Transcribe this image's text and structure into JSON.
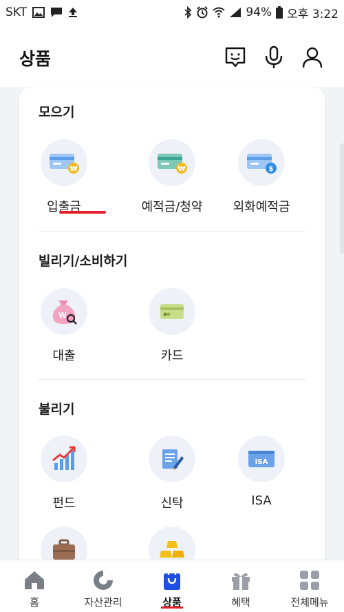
{
  "status_bar": {
    "carrier": "SKT",
    "battery": "94%",
    "time": "오후 3:22"
  },
  "header": {
    "title": "상품",
    "icons": [
      "chat-icon",
      "microphone-icon",
      "user-icon"
    ]
  },
  "sections": [
    {
      "title": "모으기",
      "items": [
        {
          "label": "입출금",
          "icon": "card-won-icon"
        },
        {
          "label": "예적금/청약",
          "icon": "card-green-won-icon"
        },
        {
          "label": "외화예적금",
          "icon": "card-dollar-icon"
        }
      ]
    },
    {
      "title": "빌리기/소비하기",
      "items": [
        {
          "label": "대출",
          "icon": "money-bag-icon"
        },
        {
          "label": "카드",
          "icon": "credit-card-icon"
        }
      ]
    },
    {
      "title": "불리기",
      "items": [
        {
          "label": "펀드",
          "icon": "growth-chart-icon"
        },
        {
          "label": "신탁",
          "icon": "document-pen-icon"
        },
        {
          "label": "ISA",
          "icon": "isa-card-icon"
        },
        {
          "label": "",
          "icon": "briefcase-icon"
        },
        {
          "label": "",
          "icon": "gold-bars-icon"
        }
      ]
    }
  ],
  "tabs": [
    {
      "label": "홈",
      "icon": "home-icon"
    },
    {
      "label": "자산관리",
      "icon": "pie-chart-icon"
    },
    {
      "label": "상품",
      "icon": "shopping-bag-icon",
      "active": true
    },
    {
      "label": "혜택",
      "icon": "gift-icon"
    },
    {
      "label": "전체메뉴",
      "icon": "grid-menu-icon"
    }
  ],
  "colors": {
    "accent_red": "#e41e2b",
    "active_tab_blue": "#1f4fe0",
    "icon_circle_bg": "#eef2f8"
  },
  "labels": {
    "isa_badge": "ISA"
  }
}
